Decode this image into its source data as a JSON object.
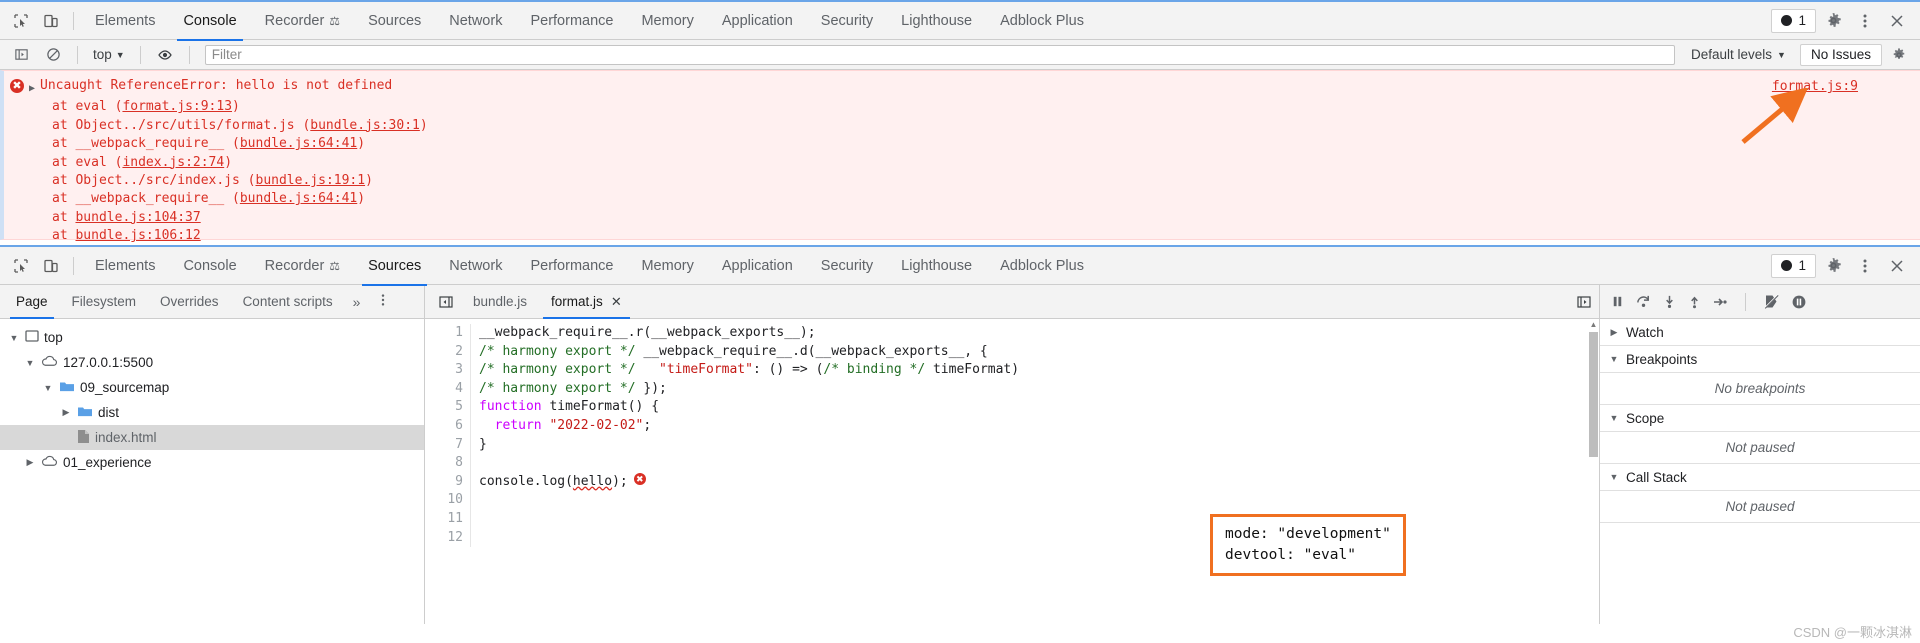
{
  "console_panel": {
    "tabs": [
      {
        "label": "Elements",
        "active": false
      },
      {
        "label": "Console",
        "active": true
      },
      {
        "label": "Recorder",
        "active": false,
        "badge": "flask"
      },
      {
        "label": "Sources",
        "active": false
      },
      {
        "label": "Network",
        "active": false
      },
      {
        "label": "Performance",
        "active": false
      },
      {
        "label": "Memory",
        "active": false
      },
      {
        "label": "Application",
        "active": false
      },
      {
        "label": "Security",
        "active": false
      },
      {
        "label": "Lighthouse",
        "active": false
      },
      {
        "label": "Adblock Plus",
        "active": false
      }
    ],
    "error_count": "1",
    "toolbar": {
      "context": "top",
      "filter_placeholder": "Filter",
      "levels": "Default levels",
      "issues": "No Issues"
    },
    "error": {
      "title": "Uncaught ReferenceError: hello is not defined",
      "source_link": "format.js:9",
      "stack": [
        {
          "prefix": "at eval (",
          "link": "format.js:9:13",
          "suffix": ")"
        },
        {
          "prefix": "at Object../src/utils/format.js (",
          "link": "bundle.js:30:1",
          "suffix": ")"
        },
        {
          "prefix": "at __webpack_require__ (",
          "link": "bundle.js:64:41",
          "suffix": ")"
        },
        {
          "prefix": "at eval (",
          "link": "index.js:2:74",
          "suffix": ")"
        },
        {
          "prefix": "at Object../src/index.js (",
          "link": "bundle.js:19:1",
          "suffix": ")"
        },
        {
          "prefix": "at __webpack_require__ (",
          "link": "bundle.js:64:41",
          "suffix": ")"
        },
        {
          "prefix": "at ",
          "link": "bundle.js:104:37",
          "suffix": ""
        },
        {
          "prefix": "at ",
          "link": "bundle.js:106:12",
          "suffix": ""
        }
      ]
    }
  },
  "sources_panel": {
    "tabs": [
      {
        "label": "Elements",
        "active": false
      },
      {
        "label": "Console",
        "active": false
      },
      {
        "label": "Recorder",
        "active": false,
        "badge": "flask"
      },
      {
        "label": "Sources",
        "active": true
      },
      {
        "label": "Network",
        "active": false
      },
      {
        "label": "Performance",
        "active": false
      },
      {
        "label": "Memory",
        "active": false
      },
      {
        "label": "Application",
        "active": false
      },
      {
        "label": "Security",
        "active": false
      },
      {
        "label": "Lighthouse",
        "active": false
      },
      {
        "label": "Adblock Plus",
        "active": false
      }
    ],
    "error_count": "1",
    "nav_tabs": [
      {
        "label": "Page",
        "active": true
      },
      {
        "label": "Filesystem",
        "active": false
      },
      {
        "label": "Overrides",
        "active": false
      },
      {
        "label": "Content scripts",
        "active": false
      }
    ],
    "nav_overflow": "»",
    "file_tree": [
      {
        "label": "top",
        "indent": 0,
        "icon": "frame",
        "twist": "open",
        "selected": false
      },
      {
        "label": "127.0.0.1:5500",
        "indent": 1,
        "icon": "cloud",
        "twist": "open",
        "selected": false
      },
      {
        "label": "09_sourcemap",
        "indent": 2,
        "icon": "folder",
        "twist": "open",
        "selected": false
      },
      {
        "label": "dist",
        "indent": 3,
        "icon": "folder",
        "twist": "closed",
        "selected": false
      },
      {
        "label": "index.html",
        "indent": 3,
        "icon": "file",
        "twist": "none",
        "selected": true
      },
      {
        "label": "01_experience",
        "indent": 1,
        "icon": "cloud",
        "twist": "closed",
        "selected": false
      }
    ],
    "editor_tabs": [
      {
        "label": "bundle.js",
        "active": false,
        "closable": false
      },
      {
        "label": "format.js",
        "active": true,
        "closable": true
      }
    ],
    "code_lines": [
      {
        "num": "1",
        "tokens": [
          {
            "t": "__webpack_require__.r(__webpack_exports__);",
            "c": "plain"
          }
        ]
      },
      {
        "num": "2",
        "tokens": [
          {
            "t": "/* harmony export */ ",
            "c": "comment"
          },
          {
            "t": "__webpack_require__.d(__webpack_exports__, {",
            "c": "plain"
          }
        ]
      },
      {
        "num": "3",
        "tokens": [
          {
            "t": "/* harmony export */ ",
            "c": "comment"
          },
          {
            "t": "  ",
            "c": "plain"
          },
          {
            "t": "\"timeFormat\"",
            "c": "str"
          },
          {
            "t": ": () => (",
            "c": "plain"
          },
          {
            "t": "/* binding */",
            "c": "comment"
          },
          {
            "t": " timeFormat)",
            "c": "plain"
          }
        ]
      },
      {
        "num": "4",
        "tokens": [
          {
            "t": "/* harmony export */ ",
            "c": "comment"
          },
          {
            "t": "});",
            "c": "plain"
          }
        ]
      },
      {
        "num": "5",
        "tokens": [
          {
            "t": "function",
            "c": "kw"
          },
          {
            "t": " timeFormat() {",
            "c": "plain"
          }
        ]
      },
      {
        "num": "6",
        "tokens": [
          {
            "t": "  ",
            "c": "plain"
          },
          {
            "t": "return",
            "c": "kw"
          },
          {
            "t": " ",
            "c": "plain"
          },
          {
            "t": "\"2022-02-02\"",
            "c": "str"
          },
          {
            "t": ";",
            "c": "plain"
          }
        ]
      },
      {
        "num": "7",
        "tokens": [
          {
            "t": "}",
            "c": "plain"
          }
        ]
      },
      {
        "num": "8",
        "tokens": []
      },
      {
        "num": "9",
        "tokens": [
          {
            "t": "console.log(",
            "c": "plain"
          },
          {
            "t": "hello",
            "c": "squig"
          },
          {
            "t": ");",
            "c": "plain"
          }
        ],
        "error_marker": "!"
      },
      {
        "num": "10",
        "tokens": []
      },
      {
        "num": "11",
        "tokens": []
      },
      {
        "num": "12",
        "tokens": []
      }
    ],
    "debugger": {
      "sections": [
        {
          "label": "Watch",
          "twist": "closed",
          "body": null
        },
        {
          "label": "Breakpoints",
          "twist": "open",
          "body": "No breakpoints"
        },
        {
          "label": "Scope",
          "twist": "open",
          "body": "Not paused"
        },
        {
          "label": "Call Stack",
          "twist": "open",
          "body": "Not paused"
        }
      ]
    }
  },
  "annotation": {
    "box_text": "mode: \"development\"\ndevtool: \"eval\"",
    "accent_color": "#f07020"
  },
  "watermark": "CSDN @一颗冰淇淋"
}
